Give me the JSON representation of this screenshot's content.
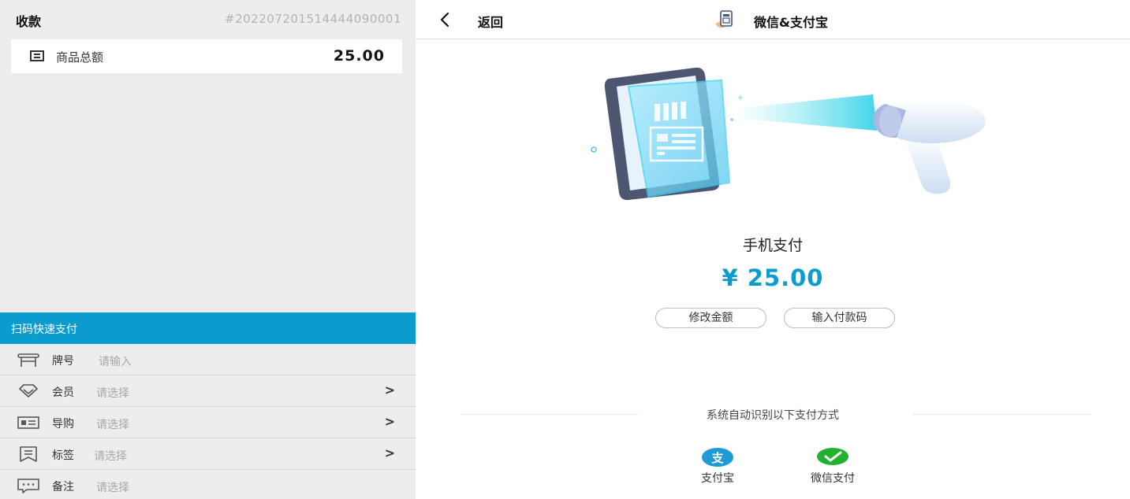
{
  "left": {
    "title": "收款",
    "order_no": "#20220720151444409000 1",
    "total": {
      "label": "商品总额",
      "value": "25.00"
    },
    "quick_pay_label": "扫码快速支付",
    "rows": [
      {
        "label": "牌号",
        "value": "请输入",
        "icon": "table-icon",
        "arrow": ""
      },
      {
        "label": "会员",
        "value": "请选择",
        "icon": "member-diamond-icon",
        "arrow": ">"
      },
      {
        "label": "导购",
        "value": "请选择",
        "icon": "id-card-icon",
        "arrow": ">"
      },
      {
        "label": "标签",
        "value": "请选择",
        "icon": "tag-flag-icon",
        "arrow": ">"
      },
      {
        "label": "备注",
        "value": "请选择",
        "icon": "comment-icon",
        "arrow": ""
      }
    ]
  },
  "right": {
    "back_label": "返回",
    "pay_title": "微信&支付宝",
    "mobile_title": "手机支付",
    "amount": "¥ 25.00",
    "buttons": {
      "modify": "修改金额",
      "code": "输入付款码"
    },
    "auto_text": "系统自动识别以下支付方式",
    "methods": [
      {
        "label": "支付宝",
        "icon": "alipay-icon",
        "color": "#1e9ad6"
      },
      {
        "label": "微信支付",
        "icon": "wechat-pay-icon",
        "color": "#22b02f"
      }
    ]
  },
  "colors": {
    "accent": "#0a9ccd",
    "panel_bg": "#ededed"
  }
}
